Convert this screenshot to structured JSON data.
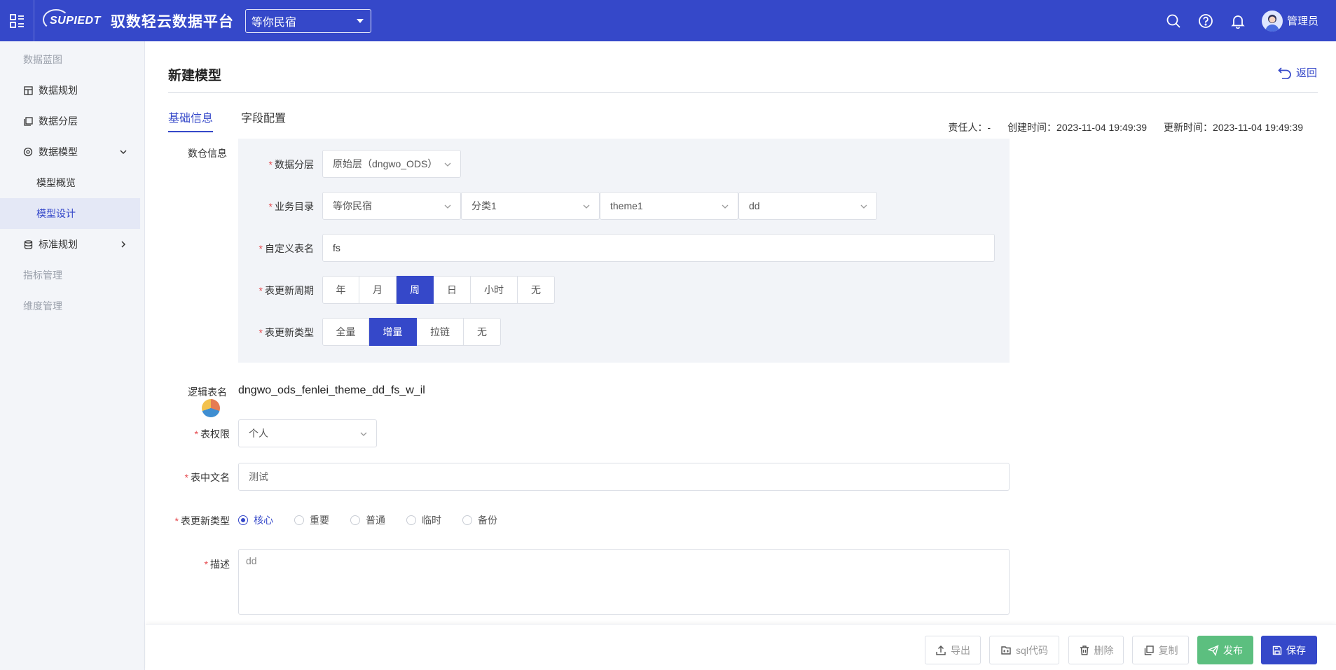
{
  "header": {
    "logo_text": "SUPIEDT",
    "platform_title": "驭数轻云数据平台",
    "tenant": "等你民宿",
    "user_name": "管理员"
  },
  "sidebar": {
    "group_blueprint": "数据蓝图",
    "item_planning": "数据规划",
    "item_layering": "数据分层",
    "item_model": "数据模型",
    "sub_overview": "模型概览",
    "sub_design": "模型设计",
    "item_standard": "标准规划",
    "group_metrics": "指标管理",
    "group_dimension": "维度管理"
  },
  "page": {
    "title": "新建模型",
    "back": "返回",
    "tab_basic": "基础信息",
    "tab_fields": "字段配置",
    "owner": "责任人：-",
    "created": "创建时间：2023-11-04 19:49:39",
    "updated": "更新时间：2023-11-04 19:49:39"
  },
  "form": {
    "dw_label": "数仓信息",
    "layer_label": "数据分层",
    "layer_value": "原始层（dngwo_ODS）",
    "catalog_label": "业务目录",
    "catalog_values": [
      "等你民宿",
      "分类1",
      "theme1",
      "dd"
    ],
    "custom_name_label": "自定义表名",
    "custom_name_value": "fs",
    "cycle_label": "表更新周期",
    "cycle_options": [
      "年",
      "月",
      "周",
      "日",
      "小时",
      "无"
    ],
    "cycle_selected": "周",
    "update_type_label": "表更新类型",
    "update_type_options": [
      "全量",
      "增量",
      "拉链",
      "无"
    ],
    "update_type_selected": "增量",
    "logic_name_label": "逻辑表名",
    "logic_name_value": "dngwo_ods_fenlei_theme_dd_fs_w_il",
    "permission_label": "表权限",
    "permission_value": "个人",
    "cn_name_label": "表中文名",
    "cn_name_value": "测试",
    "level_label": "表更新类型",
    "level_options": [
      "核心",
      "重要",
      "普通",
      "临时",
      "备份"
    ],
    "level_selected": "核心",
    "desc_label": "描述",
    "desc_value": "dd"
  },
  "footer": {
    "export": "导出",
    "sql": "sql代码",
    "delete": "删除",
    "copy": "复制",
    "publish": "发布",
    "save": "保存"
  },
  "colors": {
    "primary": "#3548c9",
    "publish": "#5cbf7f",
    "required": "#e5484d"
  }
}
